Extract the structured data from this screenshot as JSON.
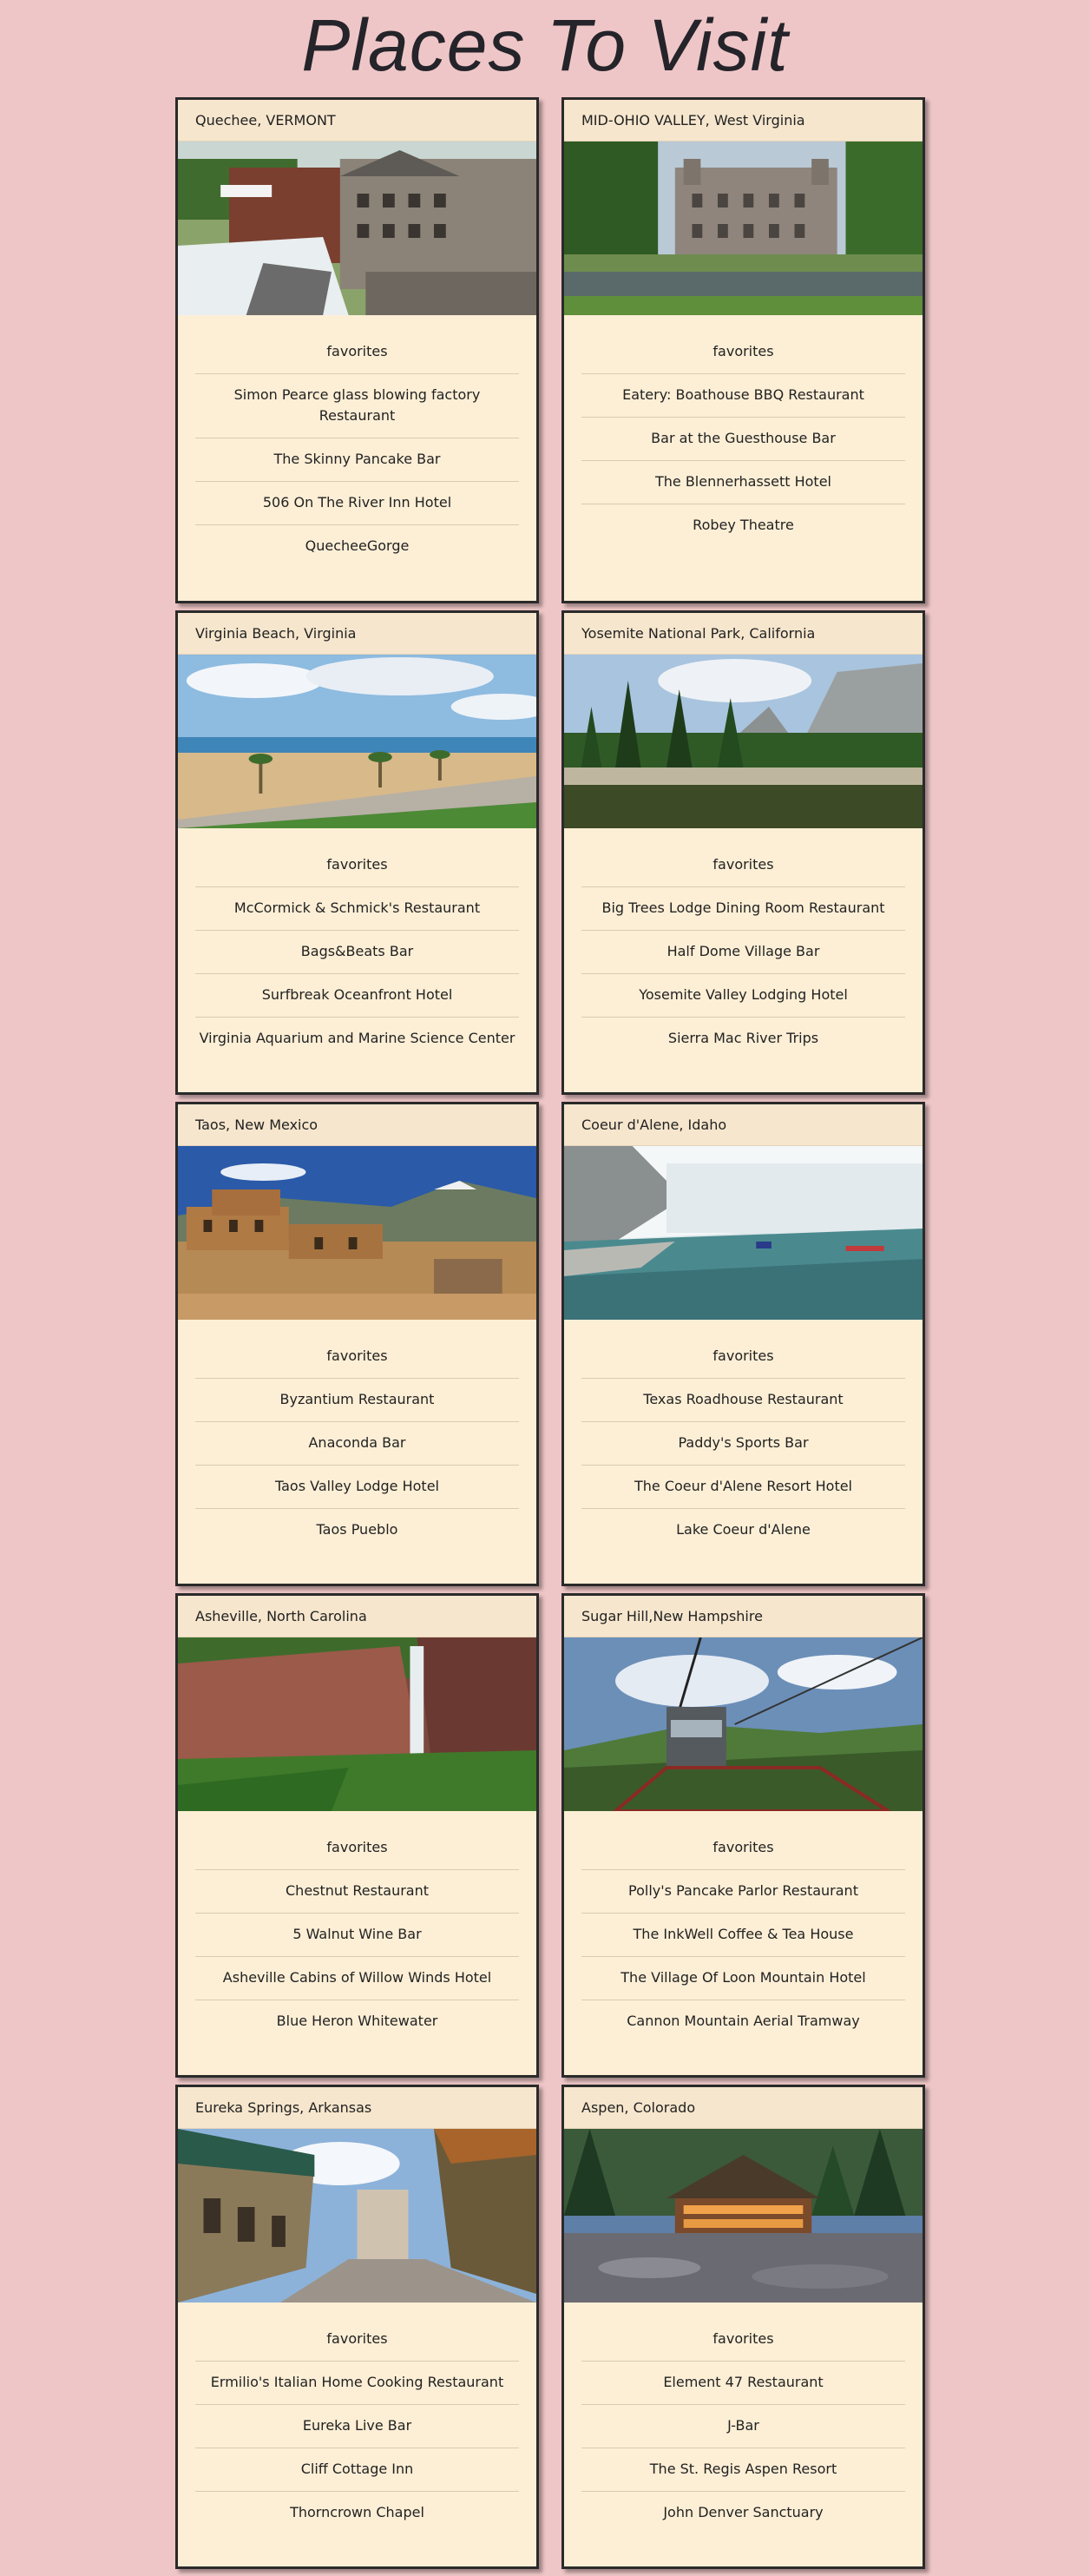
{
  "page": {
    "title": "Places To Visit",
    "background": "#efc6c7",
    "card_bg": "#fdefd6",
    "card_header_bg": "#f6e6cd"
  },
  "places": [
    {
      "name": "Quechee, VERMONT",
      "photo": "mill-waterfall-photo",
      "favorites_label": "favorites",
      "favorites": [
        "Simon Pearce glass blowing factory Restaurant",
        "The Skinny Pancake Bar",
        "506 On The River Inn Hotel",
        "QuecheeGorge"
      ]
    },
    {
      "name": "MID-OHIO VALLEY, West Virginia",
      "photo": "historic-building-photo",
      "favorites_label": "favorites",
      "favorites": [
        "Eatery: Boathouse BBQ Restaurant",
        "Bar at the Guesthouse Bar",
        "The Blennerhassett Hotel",
        "Robey Theatre"
      ]
    },
    {
      "name": "Virginia Beach, Virginia",
      "photo": "beach-photo",
      "favorites_label": "favorites",
      "favorites": [
        "McCormick & Schmick's Restaurant",
        "Bags&Beats Bar",
        "Surfbreak Oceanfront Hotel",
        "Virginia Aquarium and Marine Science Center"
      ]
    },
    {
      "name": "Yosemite National Park, California",
      "photo": "yosemite-photo",
      "favorites_label": "favorites",
      "favorites": [
        "Big Trees Lodge Dining Room Restaurant",
        "Half Dome Village Bar",
        "Yosemite Valley Lodging Hotel",
        "Sierra Mac River Trips"
      ]
    },
    {
      "name": "Taos, New Mexico",
      "photo": "pueblo-photo",
      "favorites_label": "favorites",
      "favorites": [
        "Byzantium Restaurant",
        "Anaconda Bar",
        "Taos Valley Lodge Hotel",
        "Taos Pueblo"
      ]
    },
    {
      "name": "Coeur d'Alene, Idaho",
      "photo": "waterfall-kayak-photo",
      "favorites_label": "favorites",
      "favorites": [
        "Texas Roadhouse Restaurant",
        "Paddy's Sports Bar",
        "The Coeur d'Alene Resort Hotel",
        "Lake Coeur d'Alene"
      ]
    },
    {
      "name": "Asheville, North Carolina",
      "photo": "cliff-waterfall-photo",
      "favorites_label": "favorites",
      "favorites": [
        "Chestnut Restaurant",
        "5 Walnut Wine Bar",
        "Asheville Cabins of Willow Winds Hotel",
        "Blue Heron Whitewater"
      ]
    },
    {
      "name": "Sugar Hill,New Hampshire",
      "photo": "aerial-tramway-photo",
      "favorites_label": "favorites",
      "favorites": [
        "Polly's Pancake Parlor Restaurant",
        "The InkWell Coffee & Tea House",
        "The Village Of Loon Mountain Hotel",
        "Cannon Mountain Aerial Tramway"
      ]
    },
    {
      "name": "Eureka Springs, Arkansas",
      "photo": "town-street-photo",
      "favorites_label": "favorites",
      "favorites": [
        "Ermilio's Italian Home Cooking Restaurant",
        "Eureka Live Bar",
        "Cliff Cottage Inn",
        "Thorncrown Chapel"
      ]
    },
    {
      "name": "Aspen, Colorado",
      "photo": "mountain-lodge-photo",
      "favorites_label": "favorites",
      "favorites": [
        "Element 47 Restaurant",
        "J-Bar",
        "The St. Regis Aspen Resort",
        "John Denver Sanctuary"
      ]
    }
  ]
}
